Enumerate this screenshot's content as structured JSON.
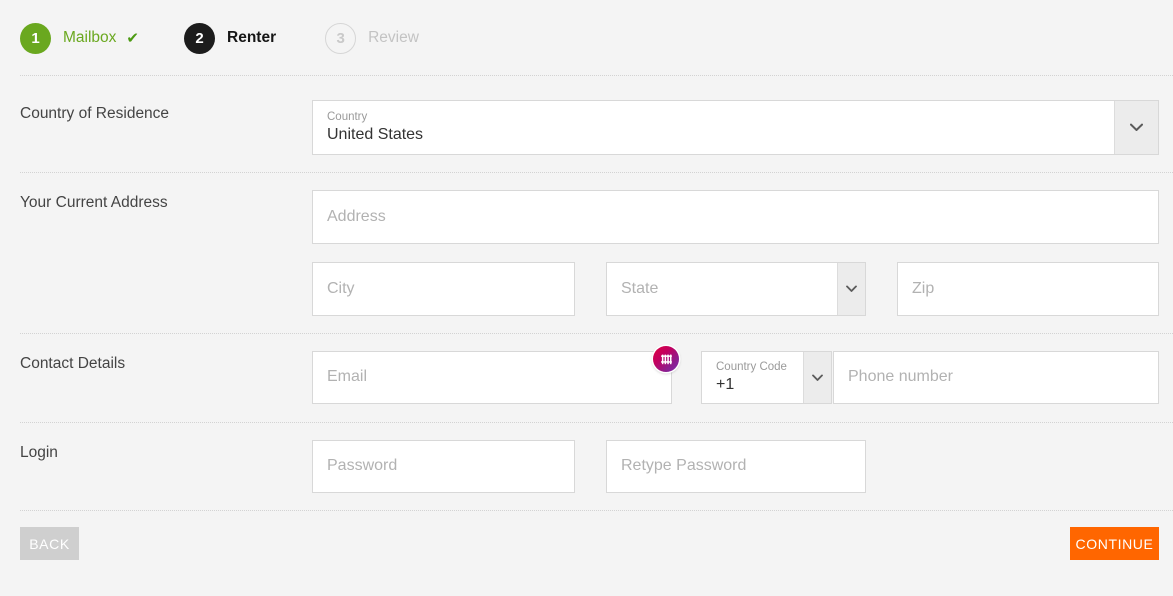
{
  "stepper": {
    "steps": [
      {
        "number": "1",
        "label": "Mailbox",
        "state": "done",
        "check": "✔"
      },
      {
        "number": "2",
        "label": "Renter",
        "state": "active"
      },
      {
        "number": "3",
        "label": "Review",
        "state": "todo"
      }
    ]
  },
  "sections": {
    "country": {
      "label": "Country of Residence",
      "country_field": {
        "float_label": "Country",
        "value": "United States",
        "dropdown_icon": "chevron-down-icon"
      }
    },
    "address": {
      "label": "Your Current Address",
      "address_placeholder": "Address",
      "city_placeholder": "City",
      "state_placeholder": "State",
      "state_dropdown_icon": "chevron-down-icon",
      "zip_placeholder": "Zip"
    },
    "contact": {
      "label": "Contact Details",
      "email_placeholder": "Email",
      "autofill_icon": "dashlane-autofill-icon",
      "country_code": {
        "float_label": "Country Code",
        "value": "+1",
        "dropdown_icon": "chevron-down-icon"
      },
      "phone_placeholder": "Phone number"
    },
    "login": {
      "label": "Login",
      "password_placeholder": "Password",
      "retype_password_placeholder": "Retype Password"
    }
  },
  "footer": {
    "back_label": "BACK",
    "continue_label": "CONTINUE"
  },
  "colors": {
    "step_done": "#6aa81f",
    "step_active": "#1c1c1c",
    "continue": "#ff6600",
    "back": "#cfcfcf",
    "page_bg": "#f4f4f4"
  }
}
